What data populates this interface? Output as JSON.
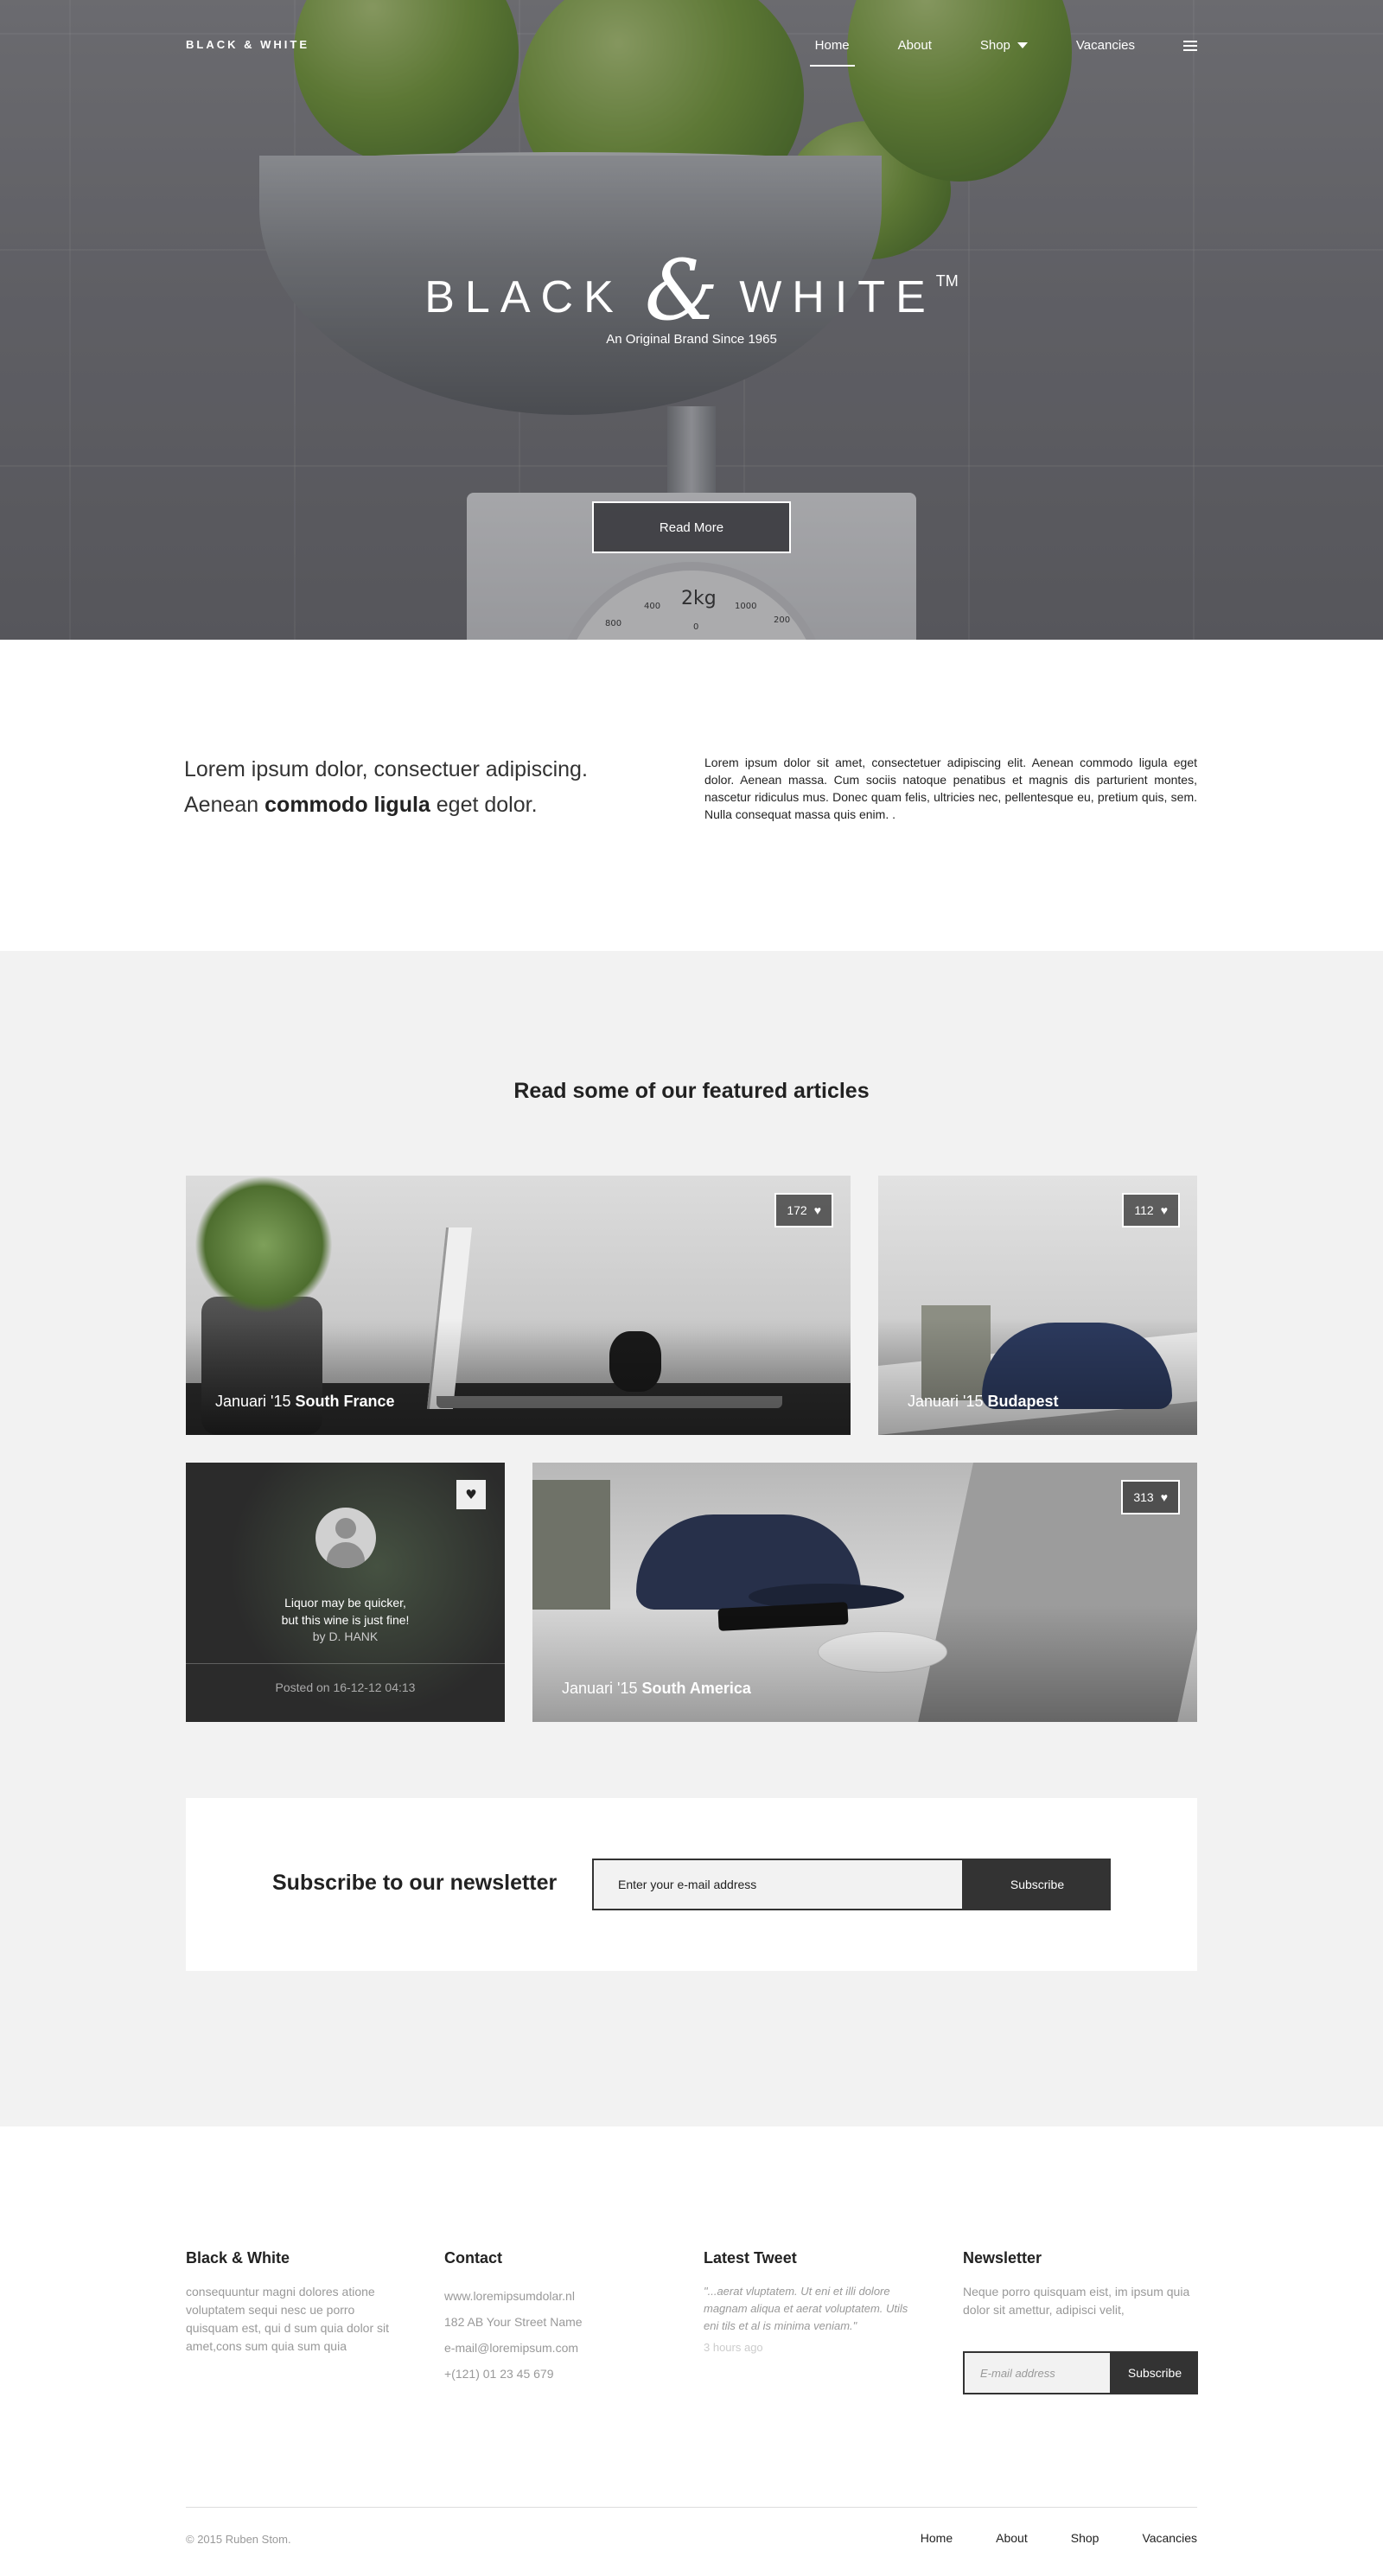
{
  "nav": {
    "brand": "BLACK & WHITE",
    "items": [
      {
        "label": "Home",
        "active": true
      },
      {
        "label": "About"
      },
      {
        "label": "Shop",
        "has_dropdown": true
      },
      {
        "label": "Vacancies"
      }
    ],
    "menu_icon": "hamburger-icon"
  },
  "hero": {
    "title_left": "BLACK",
    "title_amp": "&",
    "title_right": "WHITE",
    "trademark": "TM",
    "subtitle": "An Original Brand Since 1965",
    "button": "Read More",
    "scale_labels": [
      "2kg",
      "400",
      "1000",
      "200",
      "800",
      "0"
    ]
  },
  "intro": {
    "lead_part1": "Lorem ipsum dolor, consectuer adipiscing. Aenean ",
    "lead_bold": "commodo ligula",
    "lead_part2": " eget dolor.",
    "body": "Lorem ipsum dolor sit amet, consectetuer adipiscing elit. Aenean commodo ligula eget dolor. Aenean massa. Cum sociis natoque penatibus et magnis dis parturient montes, nascetur ridiculus mus. Donec quam felis, ultricies nec, pellentesque eu, pretium quis, sem. Nulla consequat massa quis enim. ."
  },
  "featured": {
    "title_prefix": "Read some of our ",
    "title_bold": "featured articles",
    "cards": [
      {
        "date": "Januari '15 ",
        "place": "South France",
        "likes": "172"
      },
      {
        "date": "Januari '15 ",
        "place": "Budapest",
        "likes": "112"
      },
      {
        "date": "Januari '15 ",
        "place": "South America",
        "likes": "313"
      }
    ],
    "quote": {
      "line1": "Liquor may be quicker,",
      "line2": "but this wine is just fine!",
      "author": "by D. HANK",
      "posted": "Posted on 16-12-12 04:13"
    }
  },
  "newsletter_box": {
    "title_prefix": "Subscribe to our ",
    "title_bold": "newsletter",
    "input_placeholder": "Enter your e-mail address",
    "button": "Subscribe"
  },
  "footer": {
    "col1": {
      "title": "Black & White",
      "text": "consequuntur magni dolores atione voluptatem sequi nesc ue porro quisquam est, qui d sum quia dolor sit amet,cons sum quia sum quia"
    },
    "col2": {
      "title": "Contact",
      "items": [
        "www.loremipsumdolar.nl",
        "182 AB Your Street Name",
        "e-mail@loremipsum.com",
        "+(121) 01 23 45 679"
      ]
    },
    "col3": {
      "title": "Latest Tweet",
      "tweet": "\"...aerat vluptatem. Ut eni et illi dolore magnam aliqua et aerat voluptatem. Utils eni tils  et al is minima veniam.\"",
      "ago": "3 hours ago"
    },
    "col4": {
      "title": "Newsletter",
      "text": "Neque porro quisquam eist, im ipsum quia dolor sit amettur, adipisci velit,",
      "input_placeholder": "E-mail address",
      "button": "Subscribe"
    },
    "copyright": "© 2015 Ruben Stom.",
    "links": [
      "Home",
      "About",
      "Shop",
      "Vacancies"
    ]
  }
}
